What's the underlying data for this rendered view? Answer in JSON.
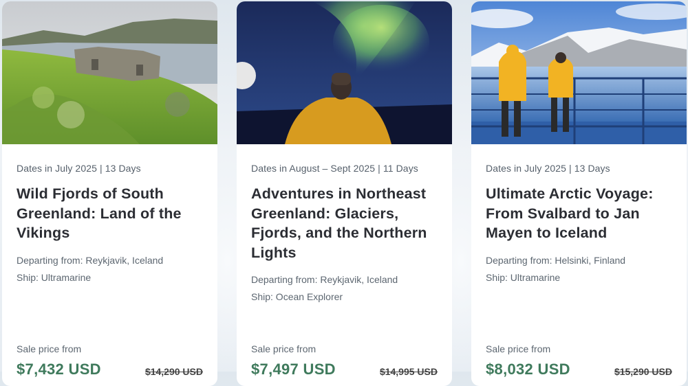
{
  "cards": [
    {
      "image_alt": "Stone ruins on a green hillside beside a fjord",
      "dates": "Dates in July 2025 | 13 Days",
      "title": "Wild Fjords of South Greenland: Land of the Vikings",
      "departing": "Departing from: Reykjavik, Iceland",
      "ship": "Ship: Ultramarine",
      "sale_label": "Sale price from",
      "price": "$7,432 USD",
      "original_price": "$14,290 USD"
    },
    {
      "image_alt": "Traveler in yellow jacket under the northern lights",
      "dates": "Dates in August – Sept 2025 | 11 Days",
      "title": "Adventures in Northeast Greenland: Glaciers, Fjords, and the Northern Lights",
      "departing": "Departing from: Reykjavik, Iceland",
      "ship": "Ship: Ocean Explorer",
      "sale_label": "Sale price from",
      "price": "$7,497 USD",
      "original_price": "$14,995 USD"
    },
    {
      "image_alt": "Two travelers in yellow jackets on a ship deck facing snowy mountains",
      "dates": "Dates in July 2025 | 13 Days",
      "title": "Ultimate Arctic Voyage: From Svalbard to Jan Mayen to Iceland",
      "departing": "Departing from: Helsinki, Finland",
      "ship": "Ship: Ultramarine",
      "sale_label": "Sale price from",
      "price": "$8,032 USD",
      "original_price": "$15,290 USD"
    }
  ],
  "colors": {
    "price_green": "#3f7a5c",
    "title_dark": "#2b2d33",
    "meta_gray": "#5c6670"
  }
}
